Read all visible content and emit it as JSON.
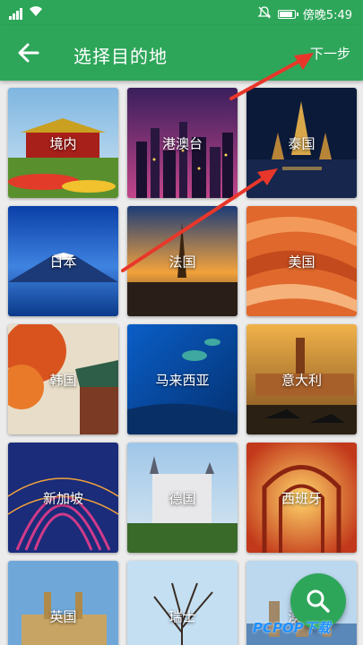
{
  "status_bar": {
    "time": "傍晚5:49",
    "icons": [
      "signal-icon",
      "wifi-icon",
      "mute-icon",
      "battery-icon"
    ]
  },
  "header": {
    "title": "选择目的地",
    "next_label": "下一步",
    "back_icon": "back-arrow-icon"
  },
  "destinations": [
    {
      "label": "境内"
    },
    {
      "label": "港澳台"
    },
    {
      "label": "泰国"
    },
    {
      "label": "日本"
    },
    {
      "label": "法国"
    },
    {
      "label": "美国"
    },
    {
      "label": "韩国"
    },
    {
      "label": "马来西亚"
    },
    {
      "label": "意大利"
    },
    {
      "label": "新加坡"
    },
    {
      "label": "德国"
    },
    {
      "label": "西班牙"
    },
    {
      "label": "英国"
    },
    {
      "label": "瑞士"
    },
    {
      "label": "澳大"
    }
  ],
  "fab": {
    "icon": "search-icon"
  },
  "watermark": {
    "text": "PCPOP下载"
  },
  "colors": {
    "primary": "#2ea65a",
    "annotation_arrow": "#e8372a",
    "background": "#ececec"
  }
}
